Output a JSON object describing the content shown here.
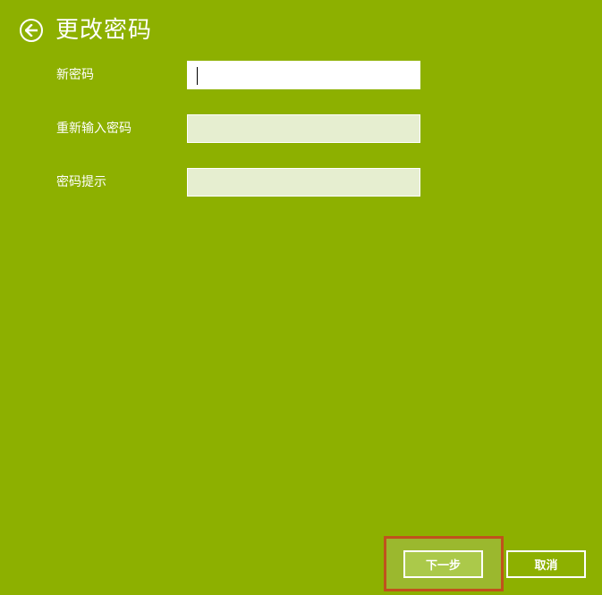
{
  "header": {
    "title": "更改密码",
    "back_icon": "arrow-left-circle-icon"
  },
  "form": {
    "fields": [
      {
        "label": "新密码",
        "value": "",
        "active": true
      },
      {
        "label": "重新输入密码",
        "value": "",
        "active": false
      },
      {
        "label": "密码提示",
        "value": "",
        "active": false
      }
    ]
  },
  "footer": {
    "next_label": "下一步",
    "cancel_label": "取消"
  },
  "colors": {
    "background": "#8db000",
    "input_fill": "#e6eed0",
    "highlight_border": "#c0521c"
  }
}
